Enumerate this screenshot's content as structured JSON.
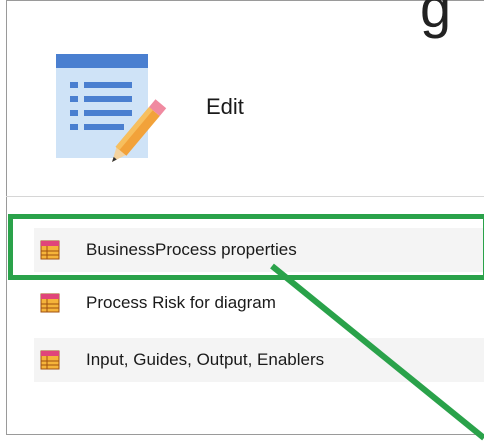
{
  "edit": {
    "label": "Edit",
    "icon": "document-edit-icon"
  },
  "menu": {
    "items": [
      {
        "label": "BusinessProcess properties",
        "icon": "table-icon"
      },
      {
        "label": "Process Risk for diagram",
        "icon": "table-icon"
      },
      {
        "label": "Input, Guides, Output, Enablers",
        "icon": "table-icon"
      }
    ]
  },
  "colors": {
    "highlight": "#2aa24a",
    "table_icon_header": "#e0457a",
    "table_icon_body": "#f5b43a",
    "edit_icon_paper": "#cfe3f7",
    "edit_icon_header": "#4a7fd0",
    "pencil": "#f2a23a"
  }
}
